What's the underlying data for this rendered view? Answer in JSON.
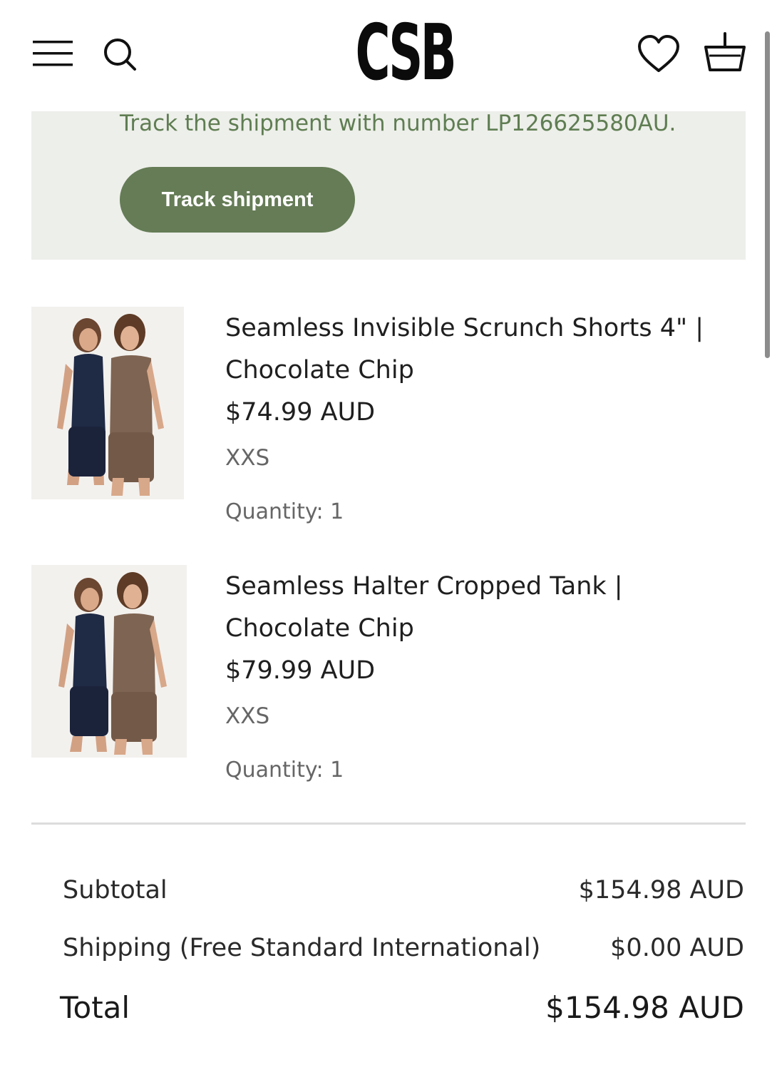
{
  "header": {
    "logo": "CSB",
    "icons": [
      "menu-icon",
      "search-icon",
      "heart-icon",
      "basket-icon"
    ]
  },
  "tracking": {
    "message": "Track the shipment with number LP126625580AU.",
    "button_label": "Track shipment",
    "accent_color": "#657c56",
    "background_color": "#edefea"
  },
  "items": [
    {
      "name": "Seamless Invisible Scrunch Shorts 4\" | Chocolate Chip",
      "price": "$74.99 AUD",
      "size": "XXS",
      "quantity": "Quantity: 1"
    },
    {
      "name": "Seamless Halter Cropped Tank | Chocolate Chip",
      "price": "$79.99 AUD",
      "size": "XXS",
      "quantity": "Quantity: 1"
    }
  ],
  "summary": {
    "subtotal_label": "Subtotal",
    "subtotal_value": "$154.98 AUD",
    "shipping_label": "Shipping (Free Standard International)",
    "shipping_value": "$0.00 AUD",
    "total_label": "Total",
    "total_value": "$154.98 AUD"
  }
}
